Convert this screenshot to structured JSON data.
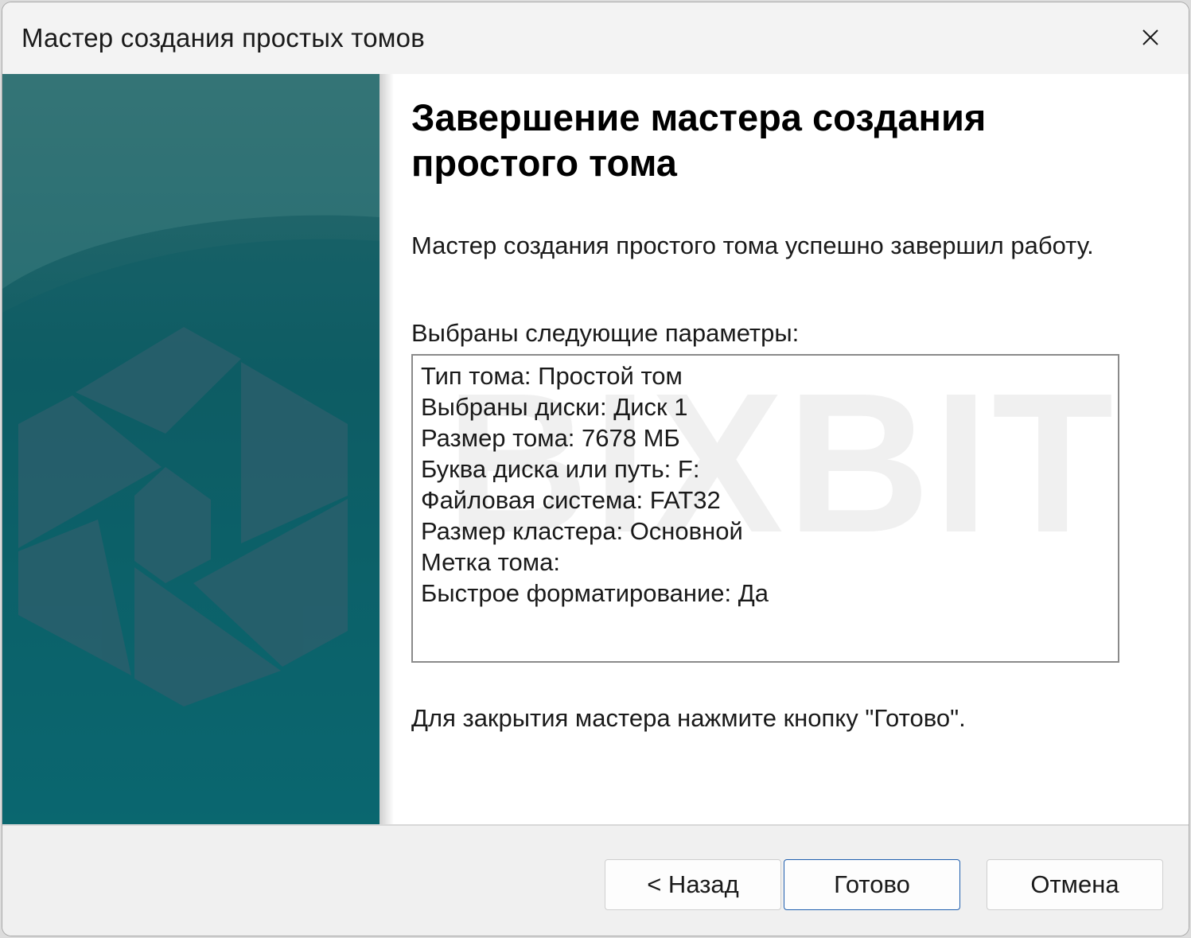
{
  "window": {
    "title": "Мастер создания простых томов"
  },
  "main": {
    "heading": "Завершение мастера создания простого тома",
    "success_text": "Мастер создания простого тома успешно завершил работу.",
    "params_label": "Выбраны следующие параметры:",
    "params": [
      "Тип тома: Простой том",
      "Выбраны диски: Диск 1",
      "Размер тома: 7678 МБ",
      "Буква диска или путь: F:",
      "Файловая система: FAT32",
      "Размер кластера: Основной",
      "Метка тома:",
      "Быстрое форматирование: Да"
    ],
    "finish_hint": "Для закрытия мастера нажмите кнопку \"Готово\"."
  },
  "buttons": {
    "back": "< Назад",
    "finish": "Готово",
    "cancel": "Отмена"
  },
  "watermark": "BIXBIT",
  "icons": {
    "close": "close-icon"
  },
  "colors": {
    "side_panel_top": "#2e6b6e",
    "side_panel_bottom": "#0a6d76",
    "finish_border": "#1f5fae"
  }
}
